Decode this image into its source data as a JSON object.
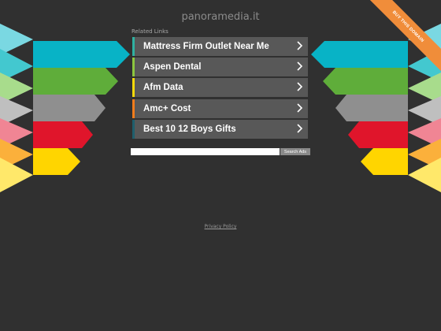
{
  "header": {
    "domain": "panoramedia.it"
  },
  "related": {
    "title": "Related Links",
    "links": [
      {
        "label": "Mattress Firm Outlet Near Me",
        "accent": "#2fb1a1"
      },
      {
        "label": "Aspen Dental",
        "accent": "#8cc63f"
      },
      {
        "label": "Afm Data",
        "accent": "#f5d90a"
      },
      {
        "label": "Amc+ Cost",
        "accent": "#f07c1b"
      },
      {
        "label": "Best 10 12 Boys Gifts",
        "accent": "#1f5f6d"
      }
    ]
  },
  "search": {
    "placeholder": "",
    "button": "Search Ads"
  },
  "footer": {
    "privacy": "Privacy Policy"
  },
  "ribbon": {
    "label": "BUY THIS DOMAIN",
    "color": "#f08d3a"
  },
  "decoration": {
    "stripe_colors": [
      "#08b3c6",
      "#5fad3a",
      "#8f8f8f",
      "#e0152b",
      "#ffd500"
    ],
    "side_colors": [
      "#7ad8e2",
      "#a8dc8c",
      "#bfbfbf",
      "#f08594",
      "#fbb03b",
      "#ffe86a"
    ]
  }
}
